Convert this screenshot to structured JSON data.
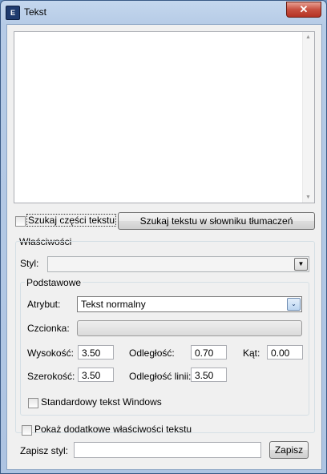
{
  "window": {
    "title": "Tekst",
    "app_icon_glyph": "E",
    "close_glyph": "✕"
  },
  "text_area": {
    "value": "",
    "scroll_up": "▲",
    "scroll_down": "▼"
  },
  "search_part": {
    "label": "Szukaj części tekstu",
    "checked": false
  },
  "search_dictionary_button": "Szukaj tekstu w słowniku tłumaczeń",
  "properties": {
    "title": "Właściwości",
    "style_label": "Styl:",
    "style_value": "",
    "basic": {
      "title": "Podstawowe",
      "attribute_label": "Atrybut:",
      "attribute_value": "Tekst normalny",
      "font_label": "Czcionka:",
      "font_value": "",
      "height_label": "Wysokość:",
      "height_value": "3.50",
      "distance_label": "Odległość:",
      "distance_value": "0.70",
      "angle_label": "Kąt:",
      "angle_value": "0.00",
      "width_label": "Szerokość:",
      "width_value": "3.50",
      "line_distance_label": "Odległość linii:",
      "line_distance_value": "3.50",
      "windows_text_label": "Standardowy tekst Windows",
      "windows_text_checked": false
    }
  },
  "show_more": {
    "label": "Pokaż dodatkowe właściwości tekstu",
    "checked": false
  },
  "save_style": {
    "label": "Zapisz styl:",
    "value": "",
    "button": "Zapisz"
  },
  "icons": {
    "dropdown": "▼",
    "dropdown_blue": "⌄"
  }
}
